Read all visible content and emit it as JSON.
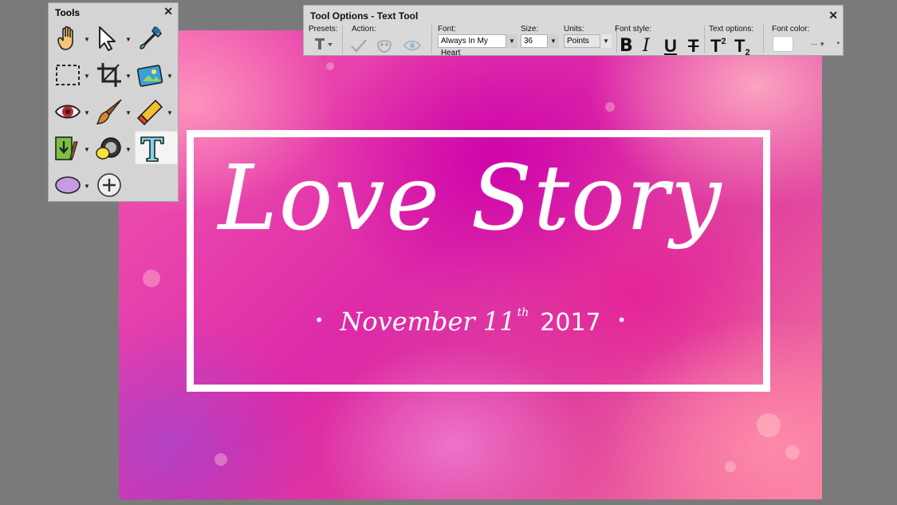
{
  "canvas": {
    "title": "Love Story",
    "date_month": "November 11",
    "date_suffix": "th",
    "date_year": "2017",
    "bullet": "•"
  },
  "tools_panel": {
    "title": "Tools",
    "close": "✕",
    "tools": [
      {
        "name": "hand-tool",
        "active": false
      },
      {
        "name": "pointer-tool",
        "active": false
      },
      {
        "name": "eyedropper-tool",
        "active": false
      },
      {
        "name": "selection-tool",
        "active": false
      },
      {
        "name": "crop-tool",
        "active": false
      },
      {
        "name": "image-tool",
        "active": false
      },
      {
        "name": "red-eye-tool",
        "active": false
      },
      {
        "name": "paint-brush-tool",
        "active": false
      },
      {
        "name": "eraser-tool",
        "active": false
      },
      {
        "name": "fill-tool",
        "active": false
      },
      {
        "name": "color-tool",
        "active": false
      },
      {
        "name": "text-tool",
        "active": true
      },
      {
        "name": "shape-tool",
        "active": false
      },
      {
        "name": "add-tool",
        "active": false
      }
    ]
  },
  "tool_options": {
    "title": "Tool Options - Text Tool",
    "close": "✕",
    "presets_label": "Presets:",
    "action_label": "Action:",
    "font_label": "Font:",
    "font_value": "Always In My Heart",
    "size_label": "Size:",
    "size_value": "36",
    "units_label": "Units:",
    "units_value": "Points",
    "font_style_label": "Font style:",
    "font_style_buttons": [
      "B",
      "I",
      "U",
      "T",
      "T",
      "T"
    ],
    "text_options_label": "Text options:",
    "font_color_label": "Font color:",
    "font_color": "#ffffff"
  }
}
